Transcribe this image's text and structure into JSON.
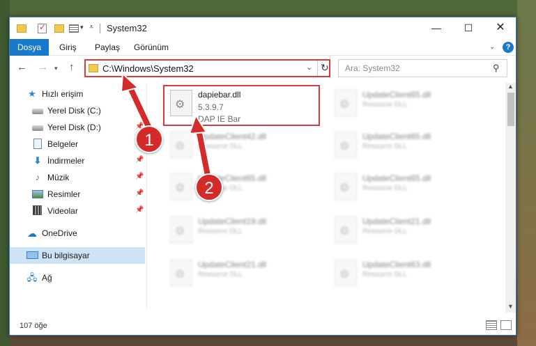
{
  "window": {
    "title": "System32",
    "buttons": {
      "minimize": "—",
      "maximize": "☐",
      "close": "✕"
    }
  },
  "ribbon": {
    "tabs": [
      "Dosya",
      "Giriş",
      "Paylaş",
      "Görünüm"
    ],
    "help": "?"
  },
  "nav": {
    "back": "←",
    "forward": "→",
    "up": "↑",
    "address": "C:\\Windows\\System32",
    "refresh": "↻",
    "search_placeholder": "Ara: System32"
  },
  "sidebar": {
    "items": [
      {
        "label": "Hızlı erişim",
        "icon": "star-icon",
        "pinned": false
      },
      {
        "label": "Yerel Disk (C:)",
        "icon": "drive-icon",
        "pinned": false
      },
      {
        "label": "Yerel Disk (D:)",
        "icon": "drive-icon",
        "pinned": true
      },
      {
        "label": "Belgeler",
        "icon": "document-icon",
        "pinned": true
      },
      {
        "label": "İndirmeler",
        "icon": "download-icon",
        "pinned": true
      },
      {
        "label": "Müzik",
        "icon": "music-icon",
        "pinned": true
      },
      {
        "label": "Resimler",
        "icon": "pictures-icon",
        "pinned": true
      },
      {
        "label": "Videolar",
        "icon": "video-icon",
        "pinned": true
      },
      {
        "label": "OneDrive",
        "icon": "cloud-icon",
        "pinned": false
      },
      {
        "label": "Bu bilgisayar",
        "icon": "computer-icon",
        "pinned": false,
        "selected": true
      },
      {
        "label": "Ağ",
        "icon": "network-icon",
        "pinned": false
      }
    ]
  },
  "files": [
    {
      "name": "dapiebar.dll",
      "version": "5.3.9.7",
      "description": "DAP IE Bar",
      "highlighted": true
    },
    {
      "name": "UpdateClient65.dll",
      "version": "Resource DLL"
    },
    {
      "name": "UpdateClient42.dll",
      "version": "Resource DLL"
    },
    {
      "name": "UpdateClient65.dll",
      "version": "Resource DLL"
    },
    {
      "name": "UpdateClient65.dll",
      "version": "Resource DLL"
    },
    {
      "name": "UpdateClient65.dll",
      "version": "Resource DLL"
    },
    {
      "name": "UpdateClient19.dll",
      "version": "Resource DLL"
    },
    {
      "name": "UpdateClient21.dll",
      "version": "Resource DLL"
    },
    {
      "name": "UpdateClient21.dll",
      "version": "Resource DLL"
    },
    {
      "name": "UpdateClient63.dll",
      "version": "Resource DLL"
    }
  ],
  "status": {
    "count": "107 öğe"
  },
  "annotations": {
    "badge1": "1",
    "badge2": "2",
    "color": "#d42a2a"
  }
}
